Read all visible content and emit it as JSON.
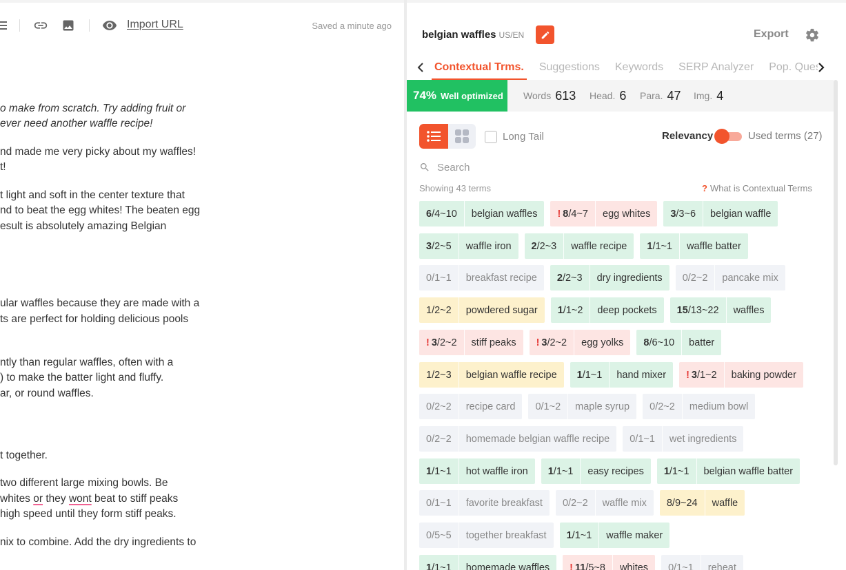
{
  "editor": {
    "toolbar": {
      "list_icon": "list-icon",
      "link_icon": "link-icon",
      "image_icon": "image-icon",
      "preview_icon": "eye-icon",
      "import_url": "Import URL",
      "saved": "Saved a minute ago"
    },
    "lines": [
      {
        "text": "o make from scratch.  Try adding fruit or",
        "italic": true
      },
      {
        "text": "ever need another waffle recipe!",
        "italic": true
      },
      {
        "text": "nd made me very picky about my waffles!"
      },
      {
        "text": "t!"
      },
      {
        "text": "t light and soft in the center texture that"
      },
      {
        "text": "nd to beat the egg whites! The beaten egg"
      },
      {
        "text": "esult is absolutely amazing Belgian"
      },
      {
        "text": "ular waffles because they are made with a"
      },
      {
        "text": "ts are perfect for holding delicious pools"
      },
      {
        "text": "ntly than regular waffles, often with a"
      },
      {
        "text": ") to make the batter light and fluffy."
      },
      {
        "text": "ar, or round waffles."
      },
      {
        "text": "t together."
      },
      {
        "text": " two different large mixing bowls. Be"
      },
      {
        "pre": " whites ",
        "sq1": "or",
        "mid": " they ",
        "sq2": "wont",
        "post": " beat to stiff peaks"
      },
      {
        "text": " high speed until they form stiff peaks."
      },
      {
        "text": "nix to combine. Add the dry ingredients to"
      }
    ]
  },
  "panel": {
    "title": "belgian waffles",
    "locale": "US/EN",
    "export_label": "Export",
    "tabs": [
      "Contextual Trms.",
      "Suggestions",
      "Keywords",
      "SERP Analyzer",
      "Pop. Questions"
    ],
    "score": {
      "percent": "74%",
      "label": "Well optimized"
    },
    "stats": [
      {
        "label": "Words",
        "value": "613"
      },
      {
        "label": "Head.",
        "value": "6"
      },
      {
        "label": "Para.",
        "value": "47"
      },
      {
        "label": "Img.",
        "value": "4"
      }
    ],
    "long_tail_label": "Long Tail",
    "relevancy_label": "Relevancy",
    "used_terms_label": "Used terms (27)",
    "search_placeholder": "Search",
    "showing": "Showing 43 terms",
    "what_is": "What is Contextual Terms",
    "colors": {
      "accent": "#f2542d",
      "good": "#21c162",
      "green_chip": "#dcf3e6",
      "red_chip": "#fde5e3",
      "yellow_chip": "#fdf1cc",
      "gray_chip": "#f1f3f7"
    }
  },
  "terms": [
    [
      {
        "used": "6",
        "range": "/4~10",
        "name": "belgian waffles",
        "status": "green"
      },
      {
        "used": "8",
        "range": "/4~7",
        "name": "egg whites",
        "status": "red",
        "warn": true
      },
      {
        "used": "3",
        "range": "/3~6",
        "name": "belgian waffle",
        "status": "green"
      }
    ],
    [
      {
        "used": "3",
        "range": "/2~5",
        "name": "waffle iron",
        "status": "green"
      },
      {
        "used": "2",
        "range": "/2~3",
        "name": "waffle recipe",
        "status": "green"
      },
      {
        "used": "1",
        "range": "/1~1",
        "name": "waffle batter",
        "status": "green"
      }
    ],
    [
      {
        "used": "0",
        "range": "/1~1",
        "name": "breakfast recipe",
        "status": "gray"
      },
      {
        "used": "2",
        "range": "/2~3",
        "name": "dry ingredients",
        "status": "green"
      },
      {
        "used": "0",
        "range": "/2~2",
        "name": "pancake mix",
        "status": "gray"
      }
    ],
    [
      {
        "used": "1",
        "range": "/2~2",
        "name": "powdered sugar",
        "status": "yellow"
      },
      {
        "used": "1",
        "range": "/1~2",
        "name": "deep pockets",
        "status": "green"
      },
      {
        "used": "15",
        "range": "/13~22",
        "name": "waffles",
        "status": "green"
      }
    ],
    [
      {
        "used": "3",
        "range": "/2~2",
        "name": "stiff peaks",
        "status": "red",
        "warn": true
      },
      {
        "used": "3",
        "range": "/2~2",
        "name": "egg yolks",
        "status": "red",
        "warn": true
      },
      {
        "used": "8",
        "range": "/6~10",
        "name": "batter",
        "status": "green"
      }
    ],
    [
      {
        "used": "1",
        "range": "/2~3",
        "name": "belgian waffle recipe",
        "status": "yellow"
      },
      {
        "used": "1",
        "range": "/1~1",
        "name": "hand mixer",
        "status": "green"
      },
      {
        "used": "3",
        "range": "/1~2",
        "name": "baking powder",
        "status": "red",
        "warn": true
      }
    ],
    [
      {
        "used": "0",
        "range": "/2~2",
        "name": "recipe card",
        "status": "gray"
      },
      {
        "used": "0",
        "range": "/1~2",
        "name": "maple syrup",
        "status": "gray"
      },
      {
        "used": "0",
        "range": "/2~2",
        "name": "medium bowl",
        "status": "gray"
      }
    ],
    [
      {
        "used": "0",
        "range": "/2~2",
        "name": "homemade belgian waffle recipe",
        "status": "gray"
      },
      {
        "used": "0",
        "range": "/1~1",
        "name": "wet ingredients",
        "status": "gray"
      }
    ],
    [
      {
        "used": "1",
        "range": "/1~1",
        "name": "hot waffle iron",
        "status": "green"
      },
      {
        "used": "1",
        "range": "/1~1",
        "name": "easy recipes",
        "status": "green"
      },
      {
        "used": "1",
        "range": "/1~1",
        "name": "belgian waffle batter",
        "status": "green"
      }
    ],
    [
      {
        "used": "0",
        "range": "/1~1",
        "name": "favorite breakfast",
        "status": "gray"
      },
      {
        "used": "0",
        "range": "/2~2",
        "name": "waffle mix",
        "status": "gray"
      },
      {
        "used": "8",
        "range": "/9~24",
        "name": "waffle",
        "status": "yellow"
      }
    ],
    [
      {
        "used": "0",
        "range": "/5~5",
        "name": "together breakfast",
        "status": "gray"
      },
      {
        "used": "1",
        "range": "/1~1",
        "name": "waffle maker",
        "status": "green"
      }
    ],
    [
      {
        "used": "1",
        "range": "/1~1",
        "name": "homemade waffles",
        "status": "green"
      },
      {
        "used": "11",
        "range": "/5~8",
        "name": "whites",
        "status": "red",
        "warn": true
      },
      {
        "used": "0",
        "range": "/1~1",
        "name": "reheat",
        "status": "gray"
      }
    ]
  ]
}
